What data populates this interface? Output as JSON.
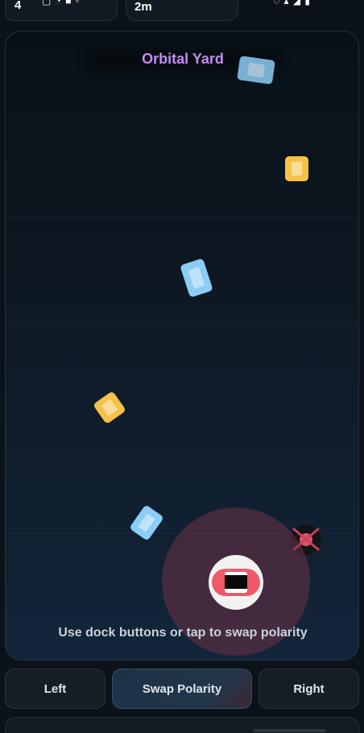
{
  "hud": {
    "left_value": "4",
    "mid_value": "2m"
  },
  "arena": {
    "title": "Orbital Yard",
    "hint": "Use dock buttons or tap to swap polarity"
  },
  "controls": {
    "left_label": "Left",
    "swap_label": "Swap Polarity",
    "right_label": "Right"
  },
  "colors": {
    "title_accent": "#c48cf0",
    "cargo_blue": "#8ccdf5",
    "cargo_gold": "#f6c14a",
    "ship_red": "#ee5a68",
    "halo": "#6e3246"
  }
}
